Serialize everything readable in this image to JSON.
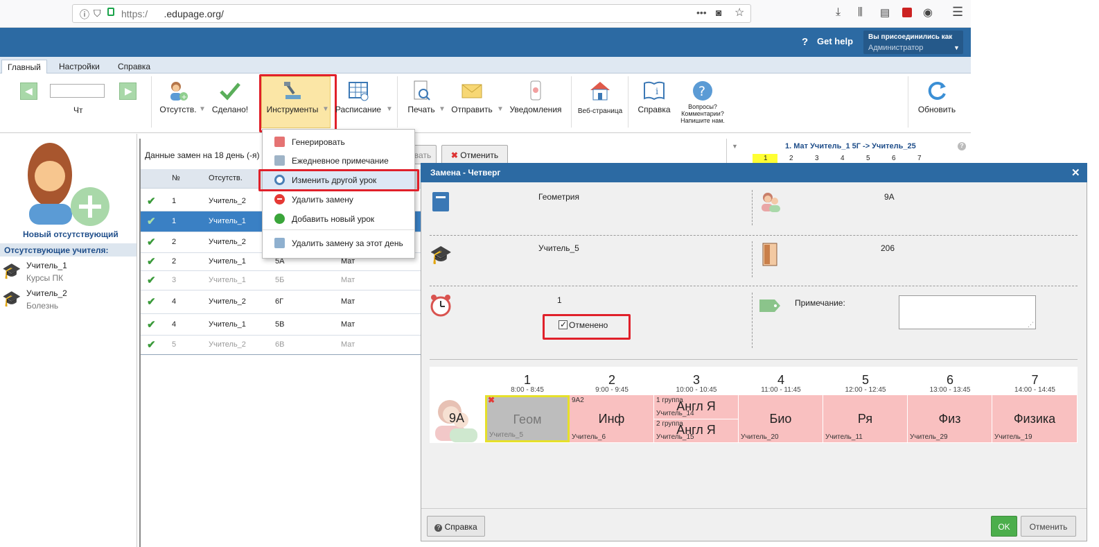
{
  "browser": {
    "url_prefix": "https:/",
    "url_domain": ".edupage.org/",
    "menu_dots": "•••"
  },
  "header": {
    "help_label": "Get help",
    "joined_as_label": "Вы присоединились как",
    "joined_as_value": "Администратор"
  },
  "menu_tabs": [
    "Главный",
    "Настройки",
    "Справка"
  ],
  "ribbon": {
    "day_label": "Чт",
    "absent": "Отсутств.",
    "done": "Сделано!",
    "tools": "Инструменты",
    "schedule": "Расписание",
    "print": "Печать",
    "send": "Отправить",
    "notifications": "Уведомления",
    "webpage": "Веб-страница",
    "help": "Справка",
    "questions": "Вопросы? Комментарии? Напишите нам.",
    "refresh": "Обновить"
  },
  "sidebar": {
    "new_absent": "Новый отсутствующий",
    "absent_heading": "Отсутствующие учителя:",
    "teachers": [
      {
        "name": "Учитель_1",
        "reason": "Курсы ПК"
      },
      {
        "name": "Учитель_2",
        "reason": "Болезнь"
      }
    ]
  },
  "list": {
    "title": "Данные замен на 18 день (-я)",
    "cancel_btn": "Отменить",
    "cancel_btn_partial": "вать",
    "col_no": "№",
    "col_absent": "Отсутств.",
    "rows": [
      {
        "no": "1",
        "teacher": "Учитель_2",
        "cls": "",
        "subj": "",
        "state": "normal"
      },
      {
        "no": "1",
        "teacher": "Учитель_1",
        "cls": "",
        "subj": "",
        "state": "selected"
      },
      {
        "no": "2",
        "teacher": "Учитель_2",
        "cls": "",
        "subj": "",
        "state": "normal"
      },
      {
        "no": "2",
        "teacher": "Учитель_1",
        "cls": "5А",
        "subj": "Мат",
        "state": "normal"
      },
      {
        "no": "3",
        "teacher": "Учитель_1",
        "cls": "5Б",
        "subj": "Мат",
        "state": "dim"
      },
      {
        "no": "4",
        "teacher": "Учитель_2",
        "cls": "6Г",
        "subj": "Мат",
        "state": "normal"
      },
      {
        "no": "4",
        "teacher": "Учитель_1",
        "cls": "5В",
        "subj": "Мат",
        "state": "normal"
      },
      {
        "no": "5",
        "teacher": "Учитель_2",
        "cls": "6В",
        "subj": "Мат",
        "state": "dim"
      }
    ]
  },
  "right_peek": {
    "title": "1. Мат Учитель_1 5Г -> Учитель_25",
    "periods": [
      "1",
      "2",
      "3",
      "4",
      "5",
      "6",
      "7"
    ]
  },
  "dropdown": {
    "items": [
      "Генерировать",
      "Ежедневное примечание",
      "Изменить другой урок",
      "Удалить замену",
      "Добавить новый урок",
      "Удалить замену за этот день"
    ]
  },
  "dialog": {
    "title": "Замена - Четверг",
    "subject": "Геометрия",
    "class": "9А",
    "teacher": "Учитель_5",
    "room": "206",
    "period": "1",
    "cancelled_label": "Отменено",
    "note_label": "Примечание:",
    "help_btn": "Справка",
    "ok_btn": "OK",
    "cancel_btn": "Отменить",
    "timetable": {
      "class_label": "9А",
      "periods": [
        {
          "num": "1",
          "time": "8:00 - 8:45"
        },
        {
          "num": "2",
          "time": "9:00 - 9:45"
        },
        {
          "num": "3",
          "time": "10:00 - 10:45"
        },
        {
          "num": "4",
          "time": "11:00 - 11:45"
        },
        {
          "num": "5",
          "time": "12:00 - 12:45"
        },
        {
          "num": "6",
          "time": "13:00 - 13:45"
        },
        {
          "num": "7",
          "time": "14:00 - 14:45"
        }
      ],
      "lessons": [
        {
          "subject": "Геом",
          "teacher": "Учитель_5",
          "top": ""
        },
        {
          "subject": "Инф",
          "teacher": "Учитель_6",
          "top": "9А2"
        },
        {
          "subject": "Англ Я",
          "teacher": "Учитель_14",
          "top": "1 группа",
          "subject2": "Англ Я",
          "teacher2": "Учитель_15",
          "top2": "2 группа"
        },
        {
          "subject": "Био",
          "teacher": "Учитель_20",
          "top": ""
        },
        {
          "subject": "Ря",
          "teacher": "Учитель_11",
          "top": ""
        },
        {
          "subject": "Физ",
          "teacher": "Учитель_29",
          "top": ""
        },
        {
          "subject": "Физика",
          "teacher": "Учитель_19",
          "top": ""
        }
      ]
    }
  },
  "colors": {
    "header_blue": "#2c6aa3",
    "lesson_pink": "#f9c0c0",
    "highlight_red": "#e0202a",
    "ok_green": "#4cae4c"
  }
}
